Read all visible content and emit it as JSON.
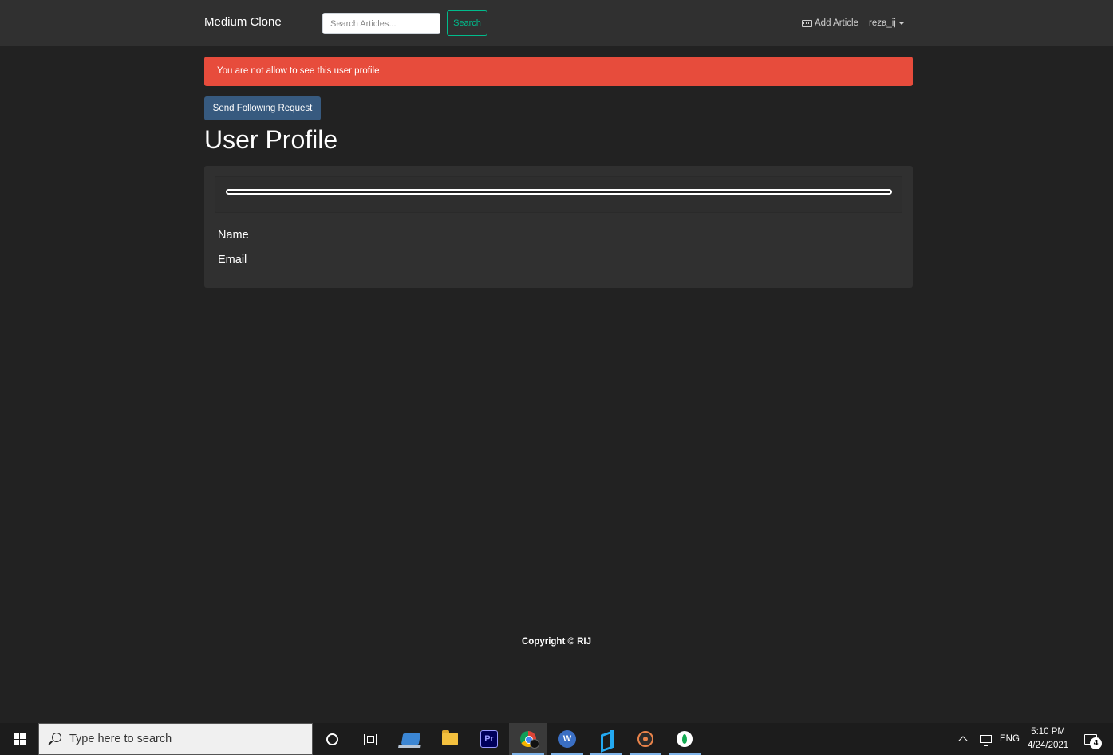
{
  "navbar": {
    "brand": "Medium Clone",
    "search_placeholder": "Search Articles...",
    "search_button": "Search",
    "add_article": "Add Article",
    "username": "reza_ij"
  },
  "alert": {
    "message": "You are not allow to see this user profile",
    "color": "#e74c3c"
  },
  "profile": {
    "follow_button": "Send Following Request",
    "title": "User Profile",
    "progress_percent": 0,
    "fields": {
      "name_label": "Name",
      "email_label": "Email"
    }
  },
  "footer": {
    "copyright": "Copyright © RIJ"
  },
  "theme": {
    "background": "#222222",
    "navbar": "#303030",
    "primary": "#375a7f",
    "success": "#00bc8c"
  },
  "taskbar": {
    "search_placeholder": "Type here to search",
    "apps": [
      "laptop-app-icon",
      "file-explorer-icon",
      "premiere-pro-icon",
      "chrome-icon",
      "wps-writer-icon",
      "vscode-icon",
      "music-disc-icon",
      "mongodb-compass-icon"
    ],
    "premiere_label": "Pr",
    "writer_label": "W",
    "language": "ENG",
    "time": "5:10 PM",
    "date": "4/24/2021",
    "notification_count": "4"
  }
}
